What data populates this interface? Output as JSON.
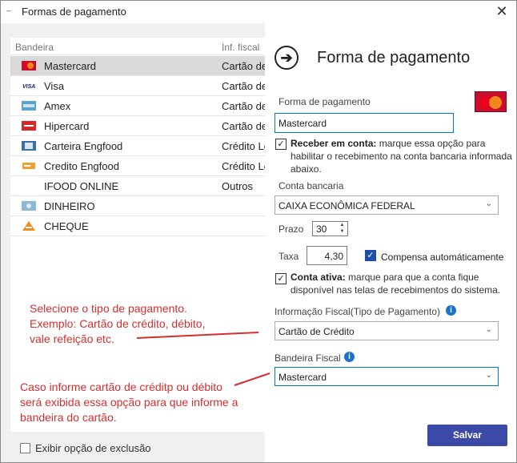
{
  "window": {
    "title": "Formas de pagamento",
    "app_icon": "_",
    "close_glyph": "✕"
  },
  "list": {
    "header_bandeira": "Bandeira",
    "header_fiscal": "Inf. fiscal",
    "rows": [
      {
        "name": "Mastercard",
        "fiscal": "Cartão de",
        "icon": "mastercard-icon"
      },
      {
        "name": "Visa",
        "fiscal": "Cartão de",
        "icon": "visa-icon"
      },
      {
        "name": "Amex",
        "fiscal": "Cartão de",
        "icon": "amex-icon"
      },
      {
        "name": "Hipercard",
        "fiscal": "Cartão de",
        "icon": "hipercard-icon"
      },
      {
        "name": "Carteira Engfood",
        "fiscal": "Crédito Lo",
        "icon": "wallet-icon"
      },
      {
        "name": "Credito Engfood",
        "fiscal": "Crédito Lo",
        "icon": "credit-icon"
      },
      {
        "name": "IFOOD ONLINE",
        "fiscal": "Outros",
        "icon": ""
      },
      {
        "name": "DINHEIRO",
        "fiscal": "",
        "icon": "cash-icon"
      },
      {
        "name": "CHEQUE",
        "fiscal": "",
        "icon": "cheque-icon"
      }
    ]
  },
  "exclusion_label": "Exibir opção de exclusão",
  "form": {
    "heading": "Forma de pagamento",
    "arrow_glyph": "➔",
    "payment_label": "Forma de pagamento",
    "payment_value": "Mastercard",
    "receive_bold": "Receber em conta:",
    "receive_text": " marque essa opção para habilitar o recebimento na conta bancaria informada abaixo.",
    "account_label": "Conta bancaria",
    "account_value": "CAIXA ECONÔMICA FEDERAL",
    "prazo_label": "Prazo",
    "prazo_value": "30",
    "taxa_label": "Taxa",
    "taxa_value": "4,30",
    "compensa_label": "Compensa automáticamente",
    "active_bold": "Conta ativa:",
    "active_text": "  marque para que a conta fique disponível nas telas de recebimentos do sistema.",
    "fiscal_info_label": "Informação Fiscal(Tipo de Pagamento)",
    "fiscal_info_value": "Cartão de Crédito",
    "fiscal_flag_label": "Bandeira Fiscal",
    "fiscal_flag_value": "Mastercard",
    "save_label": "Salvar",
    "info_glyph": "i",
    "check_glyph": "✓",
    "chevron_glyph": "⌄",
    "stepper_up": "▲",
    "stepper_down": "▼"
  },
  "annotations": {
    "note1": "Selecione o tipo de pagamento. Exemplo: Cartão de crédito, débito, vale refeição etc.",
    "note1_lines": [
      "Selecione o tipo de pagamento.",
      "Exemplo: Cartão de crédito, débito,",
      "vale refeição etc."
    ],
    "note2_lines": [
      "Caso informe cartão de créditp ou débito",
      "será exibida essa opção para que informe a",
      "bandeira do cartão."
    ]
  },
  "colors": {
    "annotation": "#d32f2f",
    "accent": "#0078d7",
    "button": "#3a4aa6",
    "selected_row": "#d9d9d9"
  }
}
